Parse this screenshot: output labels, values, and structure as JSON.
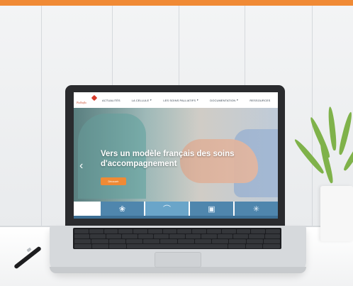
{
  "site": {
    "logo_text": "Palliaflo",
    "nav": [
      {
        "label": "ACTUALITÉS",
        "caret": false
      },
      {
        "label": "LA CELLULE",
        "caret": true
      },
      {
        "label": "LES SOINS PALLIATIFS",
        "caret": true
      },
      {
        "label": "DOCUMENTATION",
        "caret": true
      },
      {
        "label": "RESSOURCES",
        "caret": false
      }
    ],
    "hero": {
      "title": "Vers un modèle français des soins d'accompagnement",
      "button": "Découvrir",
      "prev_glyph": "‹"
    },
    "tiles": [
      "❀",
      "⌒",
      "▣",
      "✳"
    ]
  },
  "colors": {
    "accent": "#f08a35",
    "tile": "#4f86ad",
    "tile_light": "#6aa5c9"
  },
  "icons": {
    "prev": "chevron-left-icon",
    "tile_1": "flower-icon",
    "tile_2": "arch-icon",
    "tile_3": "book-icon",
    "tile_4": "asterisk-icon"
  }
}
